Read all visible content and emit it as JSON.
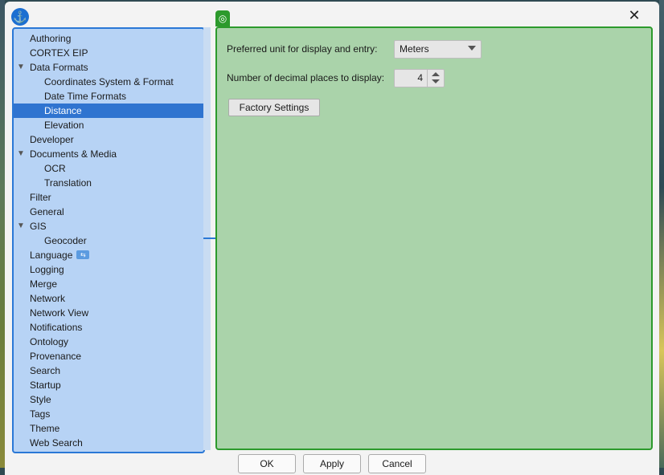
{
  "window": {
    "app_icon": "⚓",
    "close_glyph": "✕",
    "panel_icon": "◎"
  },
  "tree": [
    {
      "label": "Authoring",
      "level": 0
    },
    {
      "label": "CORTEX EIP",
      "level": 0
    },
    {
      "label": "Data Formats",
      "level": 0,
      "expanded": true
    },
    {
      "label": "Coordinates System & Format",
      "level": 1
    },
    {
      "label": "Date Time Formats",
      "level": 1
    },
    {
      "label": "Distance",
      "level": 1,
      "selected": true
    },
    {
      "label": "Elevation",
      "level": 1
    },
    {
      "label": "Developer",
      "level": 0
    },
    {
      "label": "Documents & Media",
      "level": 0,
      "expanded": true
    },
    {
      "label": "OCR",
      "level": 1
    },
    {
      "label": "Translation",
      "level": 1
    },
    {
      "label": "Filter",
      "level": 0
    },
    {
      "label": "General",
      "level": 0
    },
    {
      "label": "GIS",
      "level": 0,
      "expanded": true
    },
    {
      "label": "Geocoder",
      "level": 1
    },
    {
      "label": "Language",
      "level": 0,
      "badge": true
    },
    {
      "label": "Logging",
      "level": 0
    },
    {
      "label": "Merge",
      "level": 0
    },
    {
      "label": "Network",
      "level": 0
    },
    {
      "label": "Network View",
      "level": 0
    },
    {
      "label": "Notifications",
      "level": 0
    },
    {
      "label": "Ontology",
      "level": 0
    },
    {
      "label": "Provenance",
      "level": 0
    },
    {
      "label": "Search",
      "level": 0
    },
    {
      "label": "Startup",
      "level": 0
    },
    {
      "label": "Style",
      "level": 0
    },
    {
      "label": "Tags",
      "level": 0
    },
    {
      "label": "Theme",
      "level": 0
    },
    {
      "label": "Web Search",
      "level": 0
    }
  ],
  "settings": {
    "unit_label": "Preferred unit for display and entry:",
    "unit_value": "Meters",
    "decimals_label": "Number of decimal places to display:",
    "decimals_value": "4",
    "factory_button": "Factory Settings"
  },
  "footer": {
    "ok": "OK",
    "apply": "Apply",
    "cancel": "Cancel"
  },
  "colors": {
    "selection": "#2f74d0",
    "left_panel_bg": "#b7d3f5",
    "right_panel_bg": "#aad3aa",
    "right_border": "#2c9a2c"
  }
}
